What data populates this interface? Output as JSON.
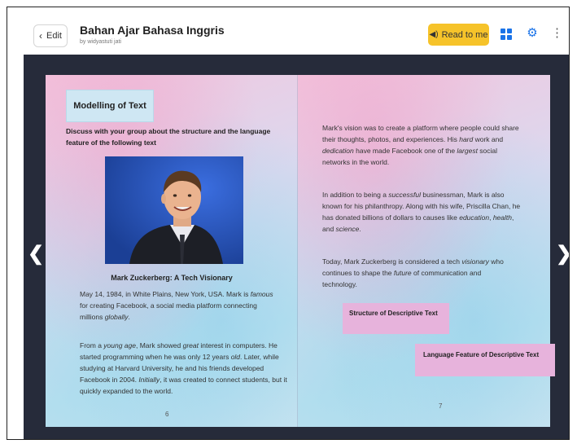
{
  "header": {
    "edit_label": "Edit",
    "title": "Bahan Ajar Bahasa Inggris",
    "byline": "by widyastuti jati",
    "read_label": "Read to me",
    "accent_color": "#f6c32a",
    "icons": [
      "chevron-left-icon",
      "speaker-icon",
      "grid-icon",
      "gear-icon",
      "more-vertical-icon"
    ]
  },
  "left_page": {
    "heading": "Modelling of Text",
    "instruction": "Discuss with your group about the structure and the language feature of the following text",
    "caption": "Mark Zuckerberg: A Tech Visionary",
    "para1": {
      "a": "May 14, 1984, in White Plains, New York, USA. Mark is ",
      "b": "famous",
      "c": " for creating Facebook, a social media platform connecting millions ",
      "d": "globally",
      "e": "."
    },
    "para2": {
      "a": "From a ",
      "b": "young age",
      "c": ", Mark showed ",
      "d": "great",
      "e": " interest in computers. He started programming when he was only 12 years ",
      "f": "old",
      "g": ". Later, while studying at Harvard University, he and his friends developed Facebook in 2004. ",
      "h": "Initially",
      "i": ", it was created to connect students, but it quickly expanded to the world."
    },
    "page_number": "6"
  },
  "right_page": {
    "para1": {
      "a": "Mark's vision was to create a platform where people could share their thoughts, photos, and experiences. His ",
      "b": "hard",
      "c": " work and ",
      "d": "dedication",
      "e": " have made Facebook one of the ",
      "f": "largest",
      "g": " social networks in the world."
    },
    "para2": {
      "a": "In addition to being a ",
      "b": "successful",
      "c": " businessman, Mark is also known for his philanthropy. Along with his wife, Priscilla Chan, he has donated billions of dollars to causes like ",
      "d": "education",
      "e": ", ",
      "f": "health",
      "g": ", and ",
      "h": "science",
      "i": "."
    },
    "para3": {
      "a": "Today, Mark Zuckerberg is considered a tech ",
      "b": "visionary",
      "c": " who continues to shape the ",
      "d": "future",
      "e": " of communication and technology."
    },
    "structure_label": "Structure of Descriptive Text",
    "language_label": "Language Feature of Descriptive Text",
    "page_number": "7"
  },
  "nav": {
    "prev_icon": "chevron-left-icon",
    "next_icon": "chevron-right-icon"
  }
}
